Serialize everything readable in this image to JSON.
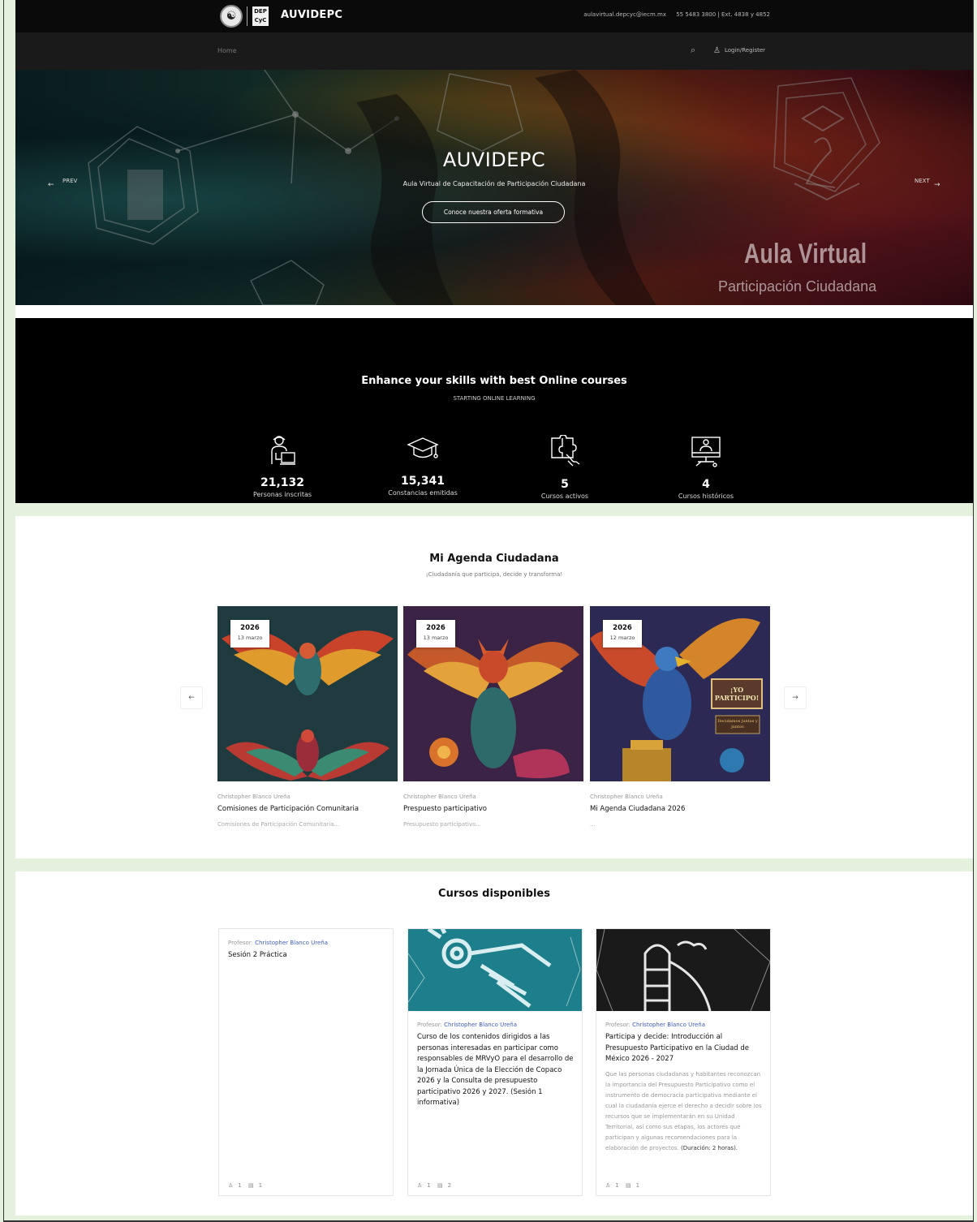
{
  "topbar": {
    "brand": "AUVIDEPC",
    "logo_circle_icon": "seal-icon",
    "logo_box_text": "DEP CyC",
    "email": "aulavirtual.depcyc@iecm.mx",
    "phone": "55 5483 3800 | Ext. 4838 y 4852"
  },
  "nav": {
    "home": "Home",
    "login": "Login/Register"
  },
  "hero": {
    "title": "AUVIDEPC",
    "subtitle": "Aula Virtual de Capacitación de Participación Ciudadana",
    "button": "Conoce nuestra oferta formativa",
    "prev": "PREV",
    "next": "NEXT",
    "bg_text_1": "Aula Virtual",
    "bg_text_2": "Participación Ciudadana"
  },
  "stats": {
    "title": "Enhance your skills with best Online courses",
    "subtitle": "STARTING ONLINE LEARNING",
    "items": [
      {
        "value": "21,132",
        "label": "Personas inscritas",
        "icon": "student-laptop-icon"
      },
      {
        "value": "15,341",
        "label": "Constancias emitidas",
        "icon": "graduation-cap-icon"
      },
      {
        "value": "5",
        "label": "Cursos activos",
        "icon": "puzzle-hand-icon"
      },
      {
        "value": "4",
        "label": "Cursos históricos",
        "icon": "monitor-teacher-icon"
      }
    ]
  },
  "agenda": {
    "title": "Mi Agenda Ciudadana",
    "subtitle": "¡Ciudadanía que participa, decide y transforma!",
    "cards": [
      {
        "year": "2026",
        "date": "13 marzo",
        "author": "Christopher Blanco Ureña",
        "title": "Comisiones de Participación Comunitaria",
        "desc": "Comisiones de Participación Comunitaria..."
      },
      {
        "year": "2026",
        "date": "13 marzo",
        "author": "Christopher Blanco Ureña",
        "title": "Prespuesto participativo",
        "desc": "Presupuesto participativo..."
      },
      {
        "year": "2026",
        "date": "12 marzo",
        "author": "Christopher Blanco Ureña",
        "title": "Mi Agenda Ciudadana 2026",
        "desc": "...",
        "sign1": "¡YO PARTICIPO!",
        "sign2": "Decidamos juntas y juntos"
      }
    ]
  },
  "cursos": {
    "title": "Cursos disponibles",
    "prof_label": "Profesor:",
    "cards": [
      {
        "prof": "Christopher Blanco Ureña",
        "title": "Sesión 2 Práctica",
        "desc": "",
        "desc_bold": "",
        "students": "1",
        "lessons": "1"
      },
      {
        "prof": "Christopher Blanco Ureña",
        "title": "Curso de los contenidos dirigidos a las personas interesadas en participar como responsables de MRVyO para el desarrollo de la Jornada Única de la Elección de Copaco 2026 y la Consulta de presupuesto participativo 2026 y 2027. (Sesión 1 informativa)",
        "desc": "",
        "desc_bold": "",
        "students": "1",
        "lessons": "2"
      },
      {
        "prof": "Christopher Blanco Ureña",
        "title": "Participa y decide: Introducción al Presupuesto Participativo en la Ciudad de México 2026 - 2027",
        "desc": "Que las personas ciudadanas y habitantes reconozcan la importancia del Presupuesto Participativo como el instrumento de democracia participativa mediante el cual la ciudadanía ejerce el derecho a decidir sobre los recursos que se implementarán en su Unidad Territorial, así como sus etapas, los actores que participan y algunas recomendaciones para la elaboración de proyectos.",
        "desc_bold": "(Duración: 2 horas).",
        "students": "1",
        "lessons": "1"
      }
    ]
  }
}
